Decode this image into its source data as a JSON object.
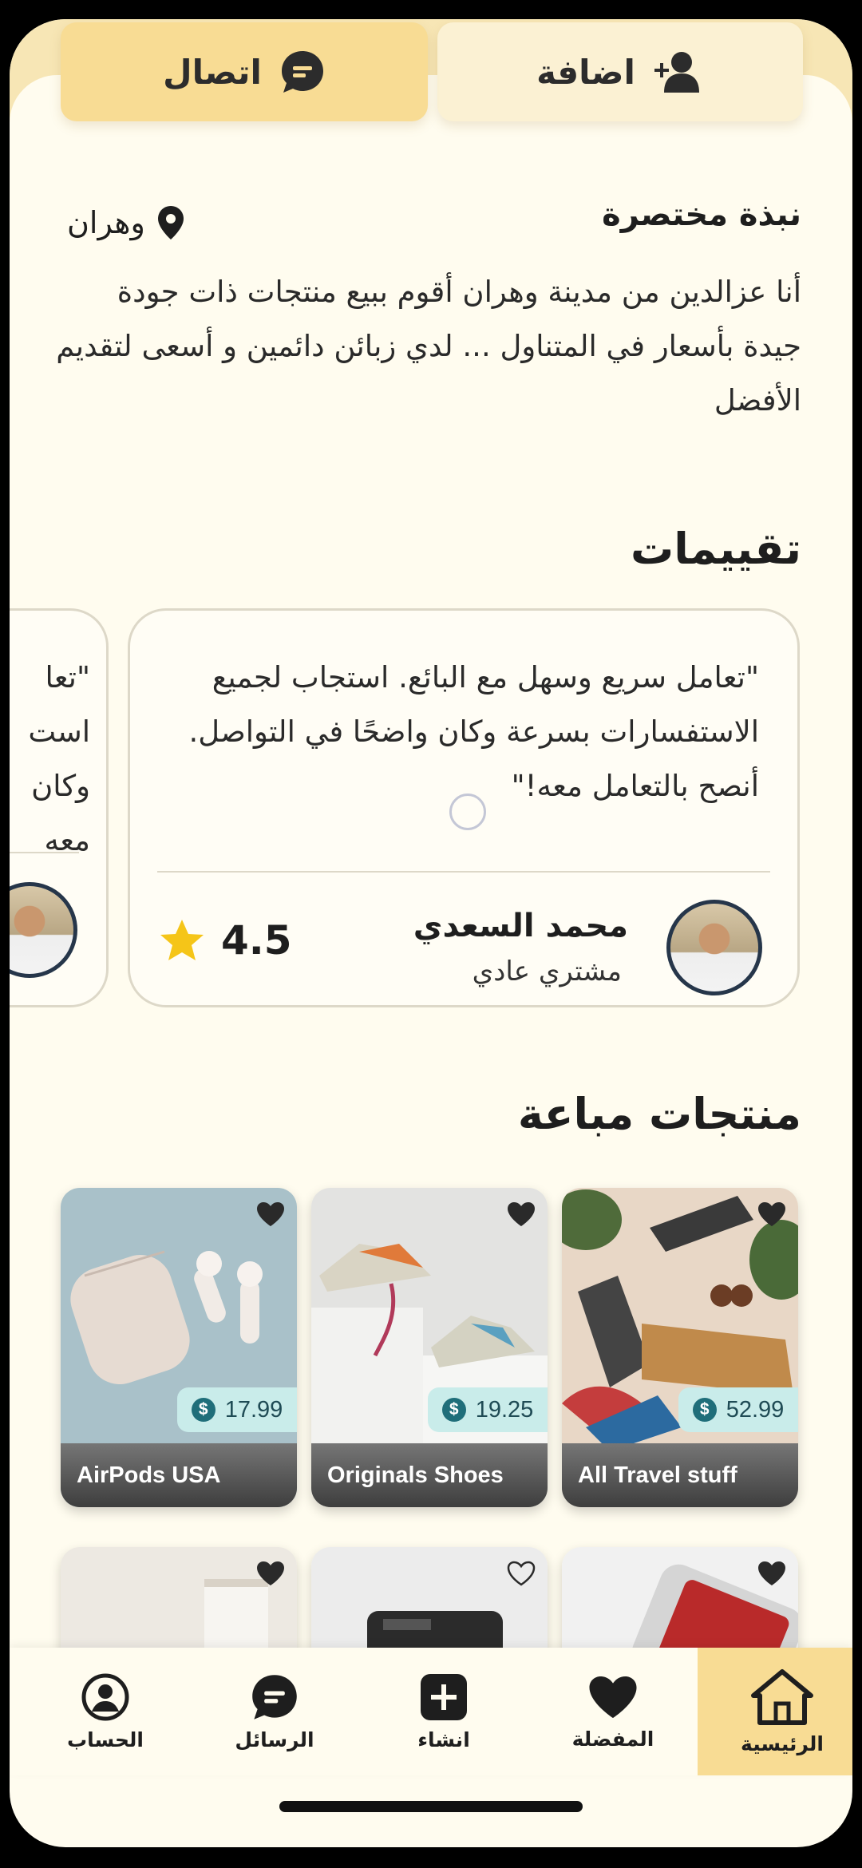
{
  "header": {
    "add_label": "اضافة",
    "contact_label": "اتصال",
    "add_icon": "add-user-icon",
    "contact_icon": "chat-icon"
  },
  "bio": {
    "title": "نبذة مختصرة",
    "location": "وهران",
    "text": "أنا عزالدين من مدينة وهران أقوم ببيع منتجات ذات جودة جيدة بأسعار في المتناول ... لدي زبائن دائمين و أسعى لتقديم الأفضل"
  },
  "reviews": {
    "title": "تقييمات",
    "items": [
      {
        "text": "\"تعامل سريع وسهل مع البائع. استجاب لجميع الاستفسارات بسرعة وكان واضحًا في التواصل. أنصح بالتعامل معه!\"",
        "name": "محمد السعدي",
        "role": "مشتري عادي",
        "rating": "4.5"
      }
    ],
    "peek_lines": [
      "\"تعا",
      "است",
      "وكان",
      "معه"
    ]
  },
  "sold": {
    "title": "منتجات مباعة",
    "products": [
      {
        "name": "All Travel stuff",
        "price": "52.99",
        "favorite": true
      },
      {
        "name": "Originals Shoes",
        "price": "19.25",
        "favorite": true
      },
      {
        "name": "AirPods USA",
        "price": "17.99",
        "favorite": true
      }
    ],
    "row2_favorites": [
      true,
      false,
      true
    ]
  },
  "nav": {
    "items": [
      {
        "label": "الرئيسية",
        "icon": "home-icon",
        "active": true
      },
      {
        "label": "المفضلة",
        "icon": "heart-icon",
        "active": false
      },
      {
        "label": "انشاء",
        "icon": "plus-square-icon",
        "active": false
      },
      {
        "label": "الرسائل",
        "icon": "chat-icon",
        "active": false
      },
      {
        "label": "الحساب",
        "icon": "user-circle-icon",
        "active": false
      }
    ]
  },
  "colors": {
    "background": "#fffcef",
    "accent": "#f8dc94",
    "price_badge": "#c9ecea"
  }
}
